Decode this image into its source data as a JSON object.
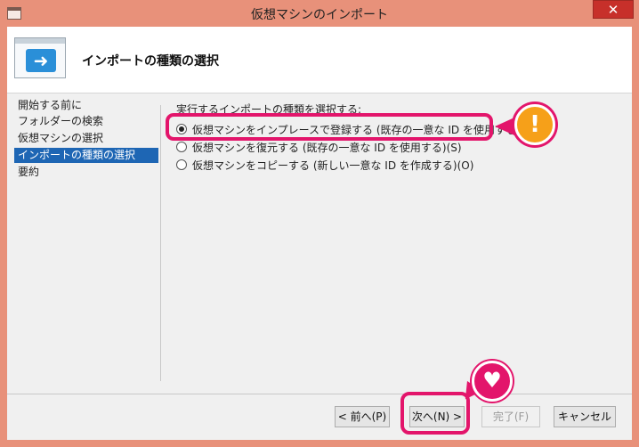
{
  "window": {
    "title": "仮想マシンのインポート",
    "close_glyph": "✕"
  },
  "header": {
    "title": "インポートの種類の選択",
    "icon": "import-arrow-icon"
  },
  "sidebar": {
    "items": [
      {
        "label": "開始する前に",
        "active": false
      },
      {
        "label": "フォルダーの検索",
        "active": false
      },
      {
        "label": "仮想マシンの選択",
        "active": false
      },
      {
        "label": "インポートの種類の選択",
        "active": true
      },
      {
        "label": "要約",
        "active": false
      }
    ]
  },
  "content": {
    "prompt": "実行するインポートの種類を選択する:",
    "options": [
      {
        "label": "仮想マシンをインプレースで登録する (既存の一意な ID を使用する)(R)",
        "checked": true
      },
      {
        "label": "仮想マシンを復元する (既存の一意な ID を使用する)(S)",
        "checked": false
      },
      {
        "label": "仮想マシンをコピーする (新しい一意な ID を作成する)(O)",
        "checked": false
      }
    ]
  },
  "buttons": {
    "back": "< 前へ(P)",
    "next": "次へ(N) >",
    "finish": "完了(F)",
    "cancel": "キャンセル"
  },
  "annotations": {
    "alert_glyph": "!",
    "heart_glyph": "♥",
    "accent_color": "#e3156b",
    "alert_color": "#f6a019"
  }
}
